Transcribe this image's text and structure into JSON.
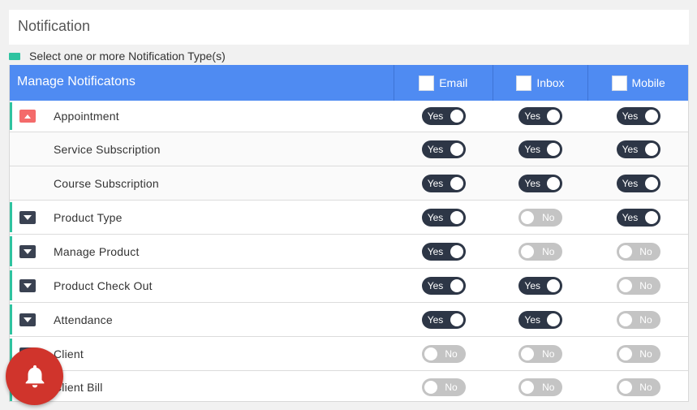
{
  "page": {
    "title": "Notification"
  },
  "hint": {
    "text": "Select one or more Notification Type(s)"
  },
  "colors": {
    "header": "#4f8bf2",
    "accent": "#2fc3a0",
    "toggle_on": "#2d3646",
    "toggle_off": "#c4c4c4",
    "expand_open": "#f46b6b",
    "bell": "#d0342c"
  },
  "table": {
    "header": {
      "name": "Manage Notificatons",
      "email": "Email",
      "inbox": "Inbox",
      "mobile": "Mobile"
    },
    "rows": [
      {
        "label": "Appointment",
        "expander": "collapse",
        "email": "Yes",
        "inbox": "Yes",
        "mobile": "Yes"
      },
      {
        "label": "Service Subscription",
        "expander": "none",
        "email": "Yes",
        "inbox": "Yes",
        "mobile": "Yes"
      },
      {
        "label": "Course Subscription",
        "expander": "none",
        "email": "Yes",
        "inbox": "Yes",
        "mobile": "Yes"
      },
      {
        "label": "Product Type",
        "expander": "expand",
        "email": "Yes",
        "inbox": "No",
        "mobile": "Yes"
      },
      {
        "label": "Manage Product",
        "expander": "expand",
        "email": "Yes",
        "inbox": "No",
        "mobile": "No"
      },
      {
        "label": "Product Check Out",
        "expander": "expand",
        "email": "Yes",
        "inbox": "Yes",
        "mobile": "No"
      },
      {
        "label": "Attendance",
        "expander": "expand",
        "email": "Yes",
        "inbox": "Yes",
        "mobile": "No"
      },
      {
        "label": "Client",
        "expander": "expand",
        "email": "No",
        "inbox": "No",
        "mobile": "No"
      },
      {
        "label": "Client Bill",
        "expander": "expand",
        "email": "No",
        "inbox": "No",
        "mobile": "No"
      }
    ]
  },
  "icons": {
    "bell": "bell-icon",
    "collapse": "chevron-up-icon",
    "expand": "chevron-down-icon"
  }
}
